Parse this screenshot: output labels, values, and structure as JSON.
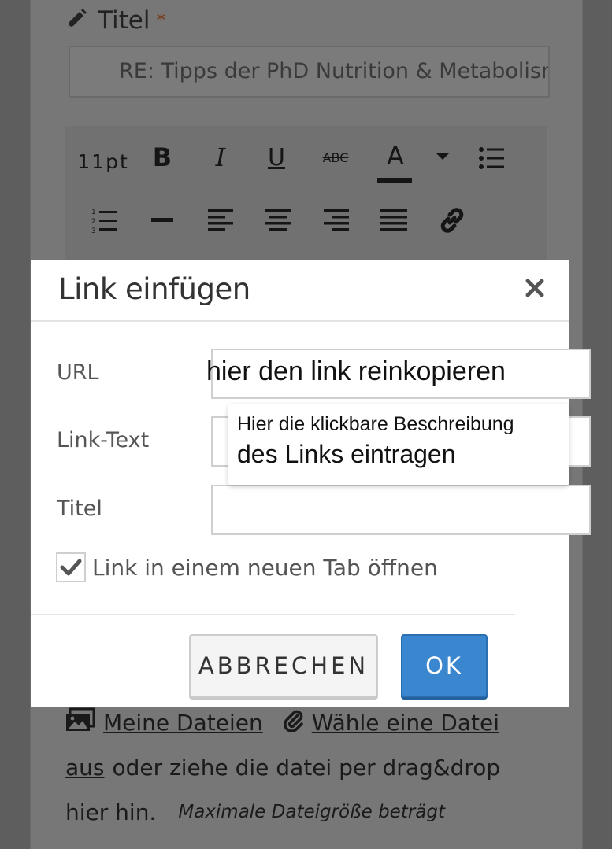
{
  "page": {
    "title_label": "Titel",
    "required_marker": "*",
    "subject_value": "RE: Tipps der PhD Nutrition & Metabolism",
    "toolbar": {
      "font_size": "11pt",
      "bold": "B",
      "italic": "I",
      "underline": "U",
      "strikethrough": "ABC",
      "font_color": "A"
    },
    "files": {
      "my_files_link": "Meine Dateien",
      "choose_file_link": "Wähle eine Datei",
      "choose_file_link_cont": "aus",
      "drag_text": "oder ziehe die datei per drag&drop",
      "drag_text_2": "hier hin.",
      "max_size_text": "Maximale Dateigröße beträgt"
    }
  },
  "modal": {
    "title": "Link einfügen",
    "close_symbol": "×",
    "url_label": "URL",
    "url_value": "hier den link reinkopieren",
    "link_text_label": "Link-Text",
    "link_text_hint_line1": "Hier die klickbare Beschreibung",
    "link_text_hint_line2": "des Links eintragen",
    "title_label": "Titel",
    "title_value": "",
    "new_tab_label": "Link in einem neuen Tab öffnen",
    "new_tab_checked": true,
    "cancel_label": "ABBRECHEN",
    "ok_label": "OK"
  },
  "colors": {
    "overlay": "#5e5e5e",
    "primary_button": "#3a86cf",
    "required_star": "#c0582c"
  }
}
